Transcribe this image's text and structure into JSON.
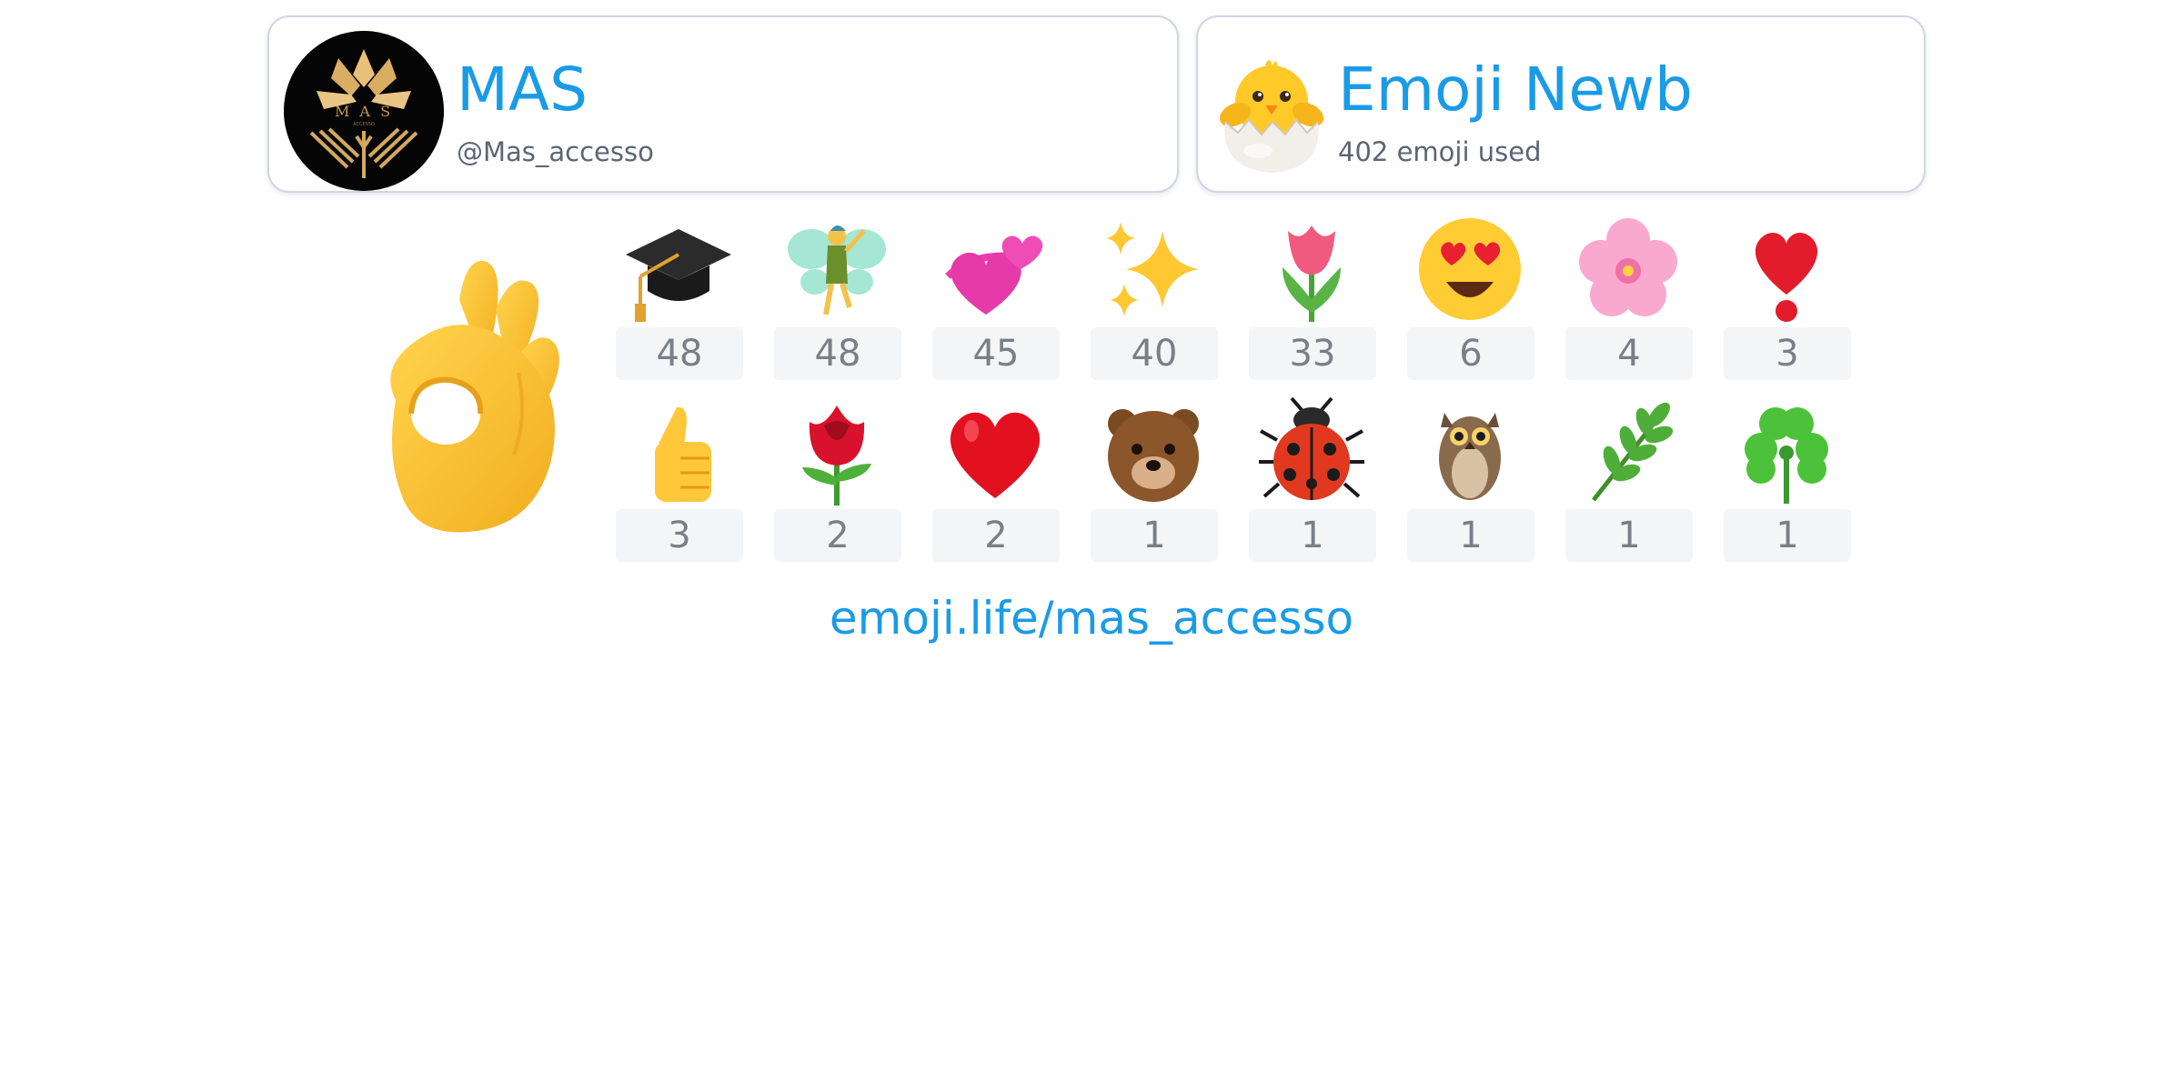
{
  "profile": {
    "name": "MAS",
    "handle": "@Mas_accesso",
    "avatar_text": "MAS"
  },
  "rank": {
    "title": "Emoji Newb",
    "subtitle": "402 emoji used",
    "icon": "hatching-chick-icon"
  },
  "top_emoji": {
    "icon": "ok-hand-icon"
  },
  "emoji_stats": [
    {
      "icon": "graduation-cap-icon",
      "count": "48"
    },
    {
      "icon": "fairy-icon",
      "count": "48"
    },
    {
      "icon": "revolving-hearts-icon",
      "count": "45"
    },
    {
      "icon": "sparkles-icon",
      "count": "40"
    },
    {
      "icon": "tulip-icon",
      "count": "33"
    },
    {
      "icon": "heart-eyes-face-icon",
      "count": "6"
    },
    {
      "icon": "cherry-blossom-icon",
      "count": "4"
    },
    {
      "icon": "heart-exclamation-icon",
      "count": "3"
    },
    {
      "icon": "thumbs-up-icon",
      "count": "3"
    },
    {
      "icon": "rose-icon",
      "count": "2"
    },
    {
      "icon": "red-heart-icon",
      "count": "2"
    },
    {
      "icon": "bear-face-icon",
      "count": "1"
    },
    {
      "icon": "lady-beetle-icon",
      "count": "1"
    },
    {
      "icon": "owl-icon",
      "count": "1"
    },
    {
      "icon": "herb-icon",
      "count": "1"
    },
    {
      "icon": "shamrock-icon",
      "count": "1"
    }
  ],
  "profile_link": "emoji.life/mas_accesso",
  "colors": {
    "accent": "#1a9be6",
    "card_border": "#cfd6e4",
    "count_bg": "#f4f5f7",
    "count_text": "#7a7f86"
  }
}
